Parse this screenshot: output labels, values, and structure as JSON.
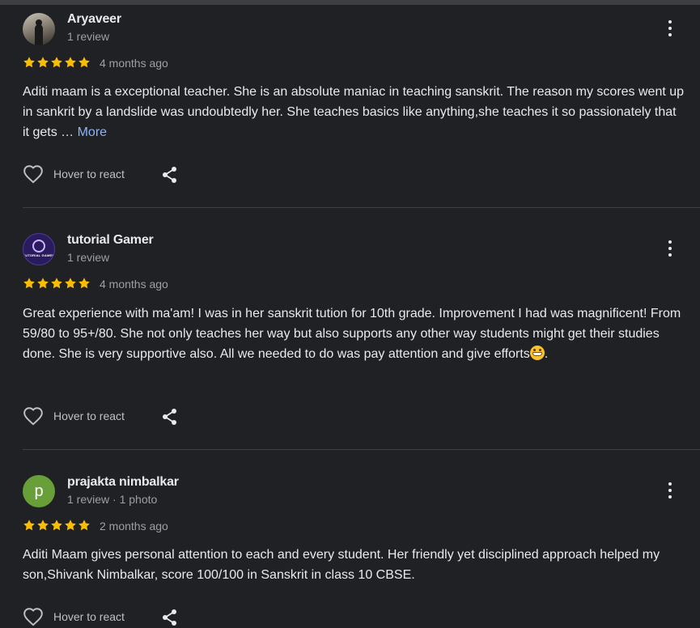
{
  "reviews": [
    {
      "name": "Aryaveer",
      "meta": "1 review",
      "avatar": {
        "type": "photo-icon"
      },
      "rating": 5,
      "time_ago": "4 months ago",
      "text": "Aditi maam is a exceptional teacher. She is an absolute maniac in teaching sanskrit. The reason my scores went up in sankrit by a landslide was undoubtedly her. She teaches basics like anything,she teaches it so passionately that it gets …",
      "more_label": "More",
      "react_label": "Hover to react"
    },
    {
      "name": "tutorial Gamer",
      "meta": "1 review",
      "avatar": {
        "type": "logo-icon",
        "text": "TUTORIAL GAMER"
      },
      "rating": 5,
      "time_ago": "4 months ago",
      "text": "Great experience with ma'am! I was in her sanskrit tution for 10th grade. Improvement I had was magnificent! From 59/80 to 95+/80. She not only teaches her way but also supports any other way students might get their studies done. She is very supportive also. All we needed to do was pay attention and give efforts",
      "text_tail": ".",
      "emoji": "grinning-face-icon",
      "react_label": "Hover to react"
    },
    {
      "name": "prajakta nimbalkar",
      "meta": "1 review · 1 photo",
      "avatar": {
        "type": "letter",
        "letter": "p",
        "color": "#689f38"
      },
      "rating": 5,
      "time_ago": "2 months ago",
      "text": "Aditi Maam gives personal attention to each and every student. Her friendly yet disciplined approach helped my son,Shivank Nimbalkar, score 100/100 in Sanskrit in class 10 CBSE.",
      "react_label": "Hover to react"
    }
  ],
  "colors": {
    "background": "#202124",
    "star": "#fbbc04",
    "link": "#8ab4f8",
    "secondary_text": "#9aa0a6"
  }
}
